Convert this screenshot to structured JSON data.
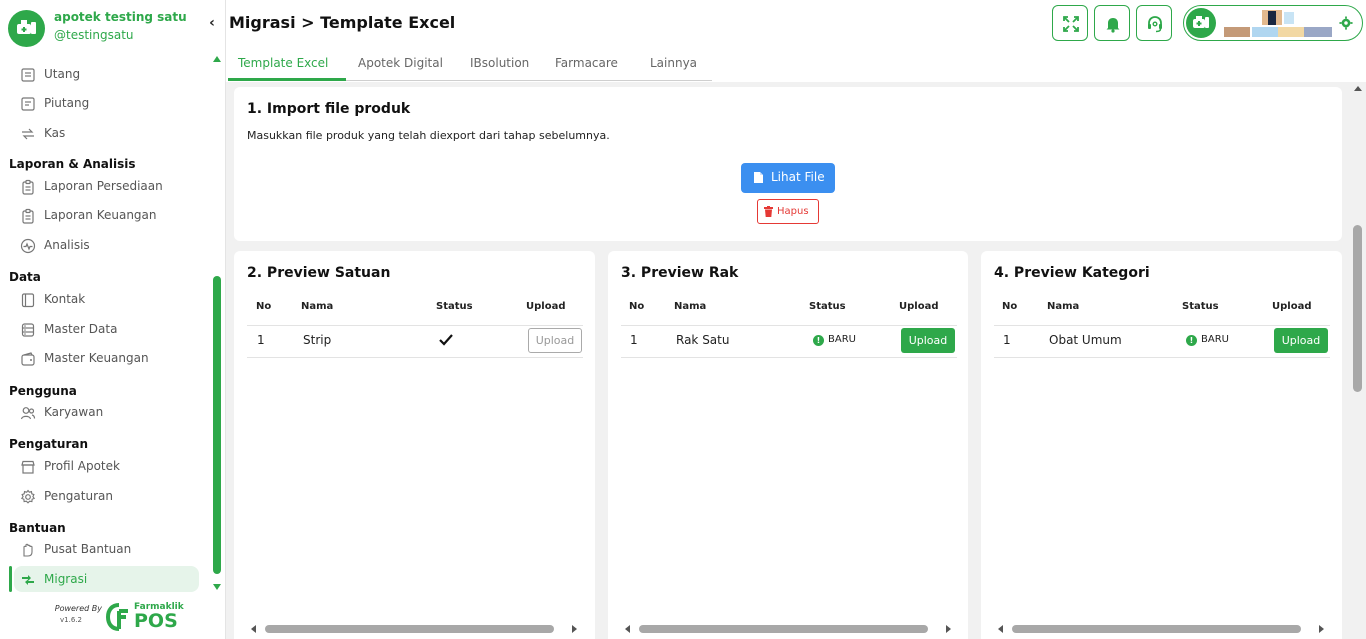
{
  "brand": {
    "name": "apotek testing satu",
    "handle": "@testingsatu"
  },
  "sidebar": {
    "items_top": [
      {
        "label": "Utang",
        "icon": "ledger-icon"
      },
      {
        "label": "Piutang",
        "icon": "receipt-icon"
      },
      {
        "label": "Kas",
        "icon": "cash-transfer-icon"
      }
    ],
    "sections": [
      {
        "title": "Laporan & Analisis",
        "items": [
          {
            "label": "Laporan Persediaan",
            "icon": "clipboard-icon"
          },
          {
            "label": "Laporan Keuangan",
            "icon": "clipboard-icon"
          },
          {
            "label": "Analisis",
            "icon": "pulse-icon"
          }
        ]
      },
      {
        "title": "Data",
        "items": [
          {
            "label": "Kontak",
            "icon": "contact-book-icon"
          },
          {
            "label": "Master Data",
            "icon": "database-icon"
          },
          {
            "label": "Master Keuangan",
            "icon": "wallet-icon"
          }
        ]
      },
      {
        "title": "Pengguna",
        "items": [
          {
            "label": "Karyawan",
            "icon": "users-icon"
          }
        ]
      },
      {
        "title": "Pengaturan",
        "items": [
          {
            "label": "Profil Apotek",
            "icon": "store-icon"
          },
          {
            "label": "Pengaturan",
            "icon": "gear-icon"
          }
        ]
      },
      {
        "title": "Bantuan",
        "items": [
          {
            "label": "Pusat Bantuan",
            "icon": "hand-icon"
          },
          {
            "label": "Migrasi",
            "icon": "migrate-icon",
            "active": true
          }
        ]
      }
    ]
  },
  "footer": {
    "powered": "Powered By",
    "version": "v1.6.2",
    "product_name": "Farmaklik",
    "product_pos": "POS"
  },
  "header": {
    "title": "Migrasi > Template Excel"
  },
  "tabs": [
    "Template Excel",
    "Apotek Digital",
    "IBsolution",
    "Farmacare",
    "Lainnya"
  ],
  "import": {
    "title": "1. Import file produk",
    "description": "Masukkan file produk yang telah diexport dari tahap sebelumnya.",
    "view_button": "Lihat File",
    "delete_button": "Hapus"
  },
  "previews": [
    {
      "title": "2. Preview Satuan",
      "columns": [
        "No",
        "Nama",
        "Status",
        "Upload"
      ],
      "rows": [
        {
          "no": "1",
          "nama": "Strip",
          "status": "check",
          "upload": "Upload",
          "upload_enabled": false
        }
      ]
    },
    {
      "title": "3. Preview Rak",
      "columns": [
        "No",
        "Nama",
        "Status",
        "Upload"
      ],
      "rows": [
        {
          "no": "1",
          "nama": "Rak Satu",
          "status": "BARU",
          "upload": "Upload",
          "upload_enabled": true
        }
      ]
    },
    {
      "title": "4. Preview Kategori",
      "columns": [
        "No",
        "Nama",
        "Status",
        "Upload"
      ],
      "rows": [
        {
          "no": "1",
          "nama": "Obat Umum",
          "status": "BARU",
          "upload": "Upload",
          "upload_enabled": true
        }
      ]
    }
  ],
  "colors": {
    "accent": "#2ea84a",
    "primary_button": "#3b8ff0",
    "danger": "#e53935"
  }
}
